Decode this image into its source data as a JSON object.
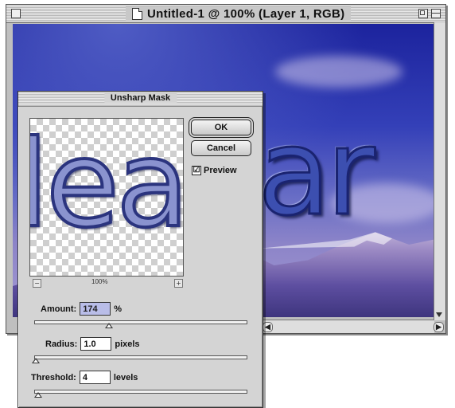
{
  "document": {
    "title": "Untitled-1 @ 100% (Layer 1, RGB)",
    "canvas_text": "ar"
  },
  "dialog": {
    "title": "Unsharp Mask",
    "preview_text": "lea",
    "zoom": "100%",
    "zoom_out_symbol": "−",
    "zoom_in_symbol": "+",
    "ok_label": "OK",
    "cancel_label": "Cancel",
    "preview_label": "Preview",
    "preview_checked": "☑",
    "amount": {
      "label": "Amount:",
      "value": "174",
      "unit": "%",
      "level": 0.348
    },
    "radius": {
      "label": "Radius:",
      "value": "1.0",
      "unit": "pixels",
      "level": 0.004
    },
    "threshold": {
      "label": "Threshold:",
      "value": "4",
      "unit": "levels",
      "level": 0.016
    }
  },
  "icons": [
    "document-icon",
    "close-box-icon",
    "zoom-box-icon",
    "collapse-box-icon",
    "scroll-arrow-icon"
  ]
}
